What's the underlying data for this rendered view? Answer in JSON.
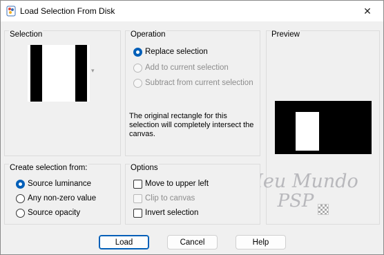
{
  "window": {
    "title": "Load Selection From Disk",
    "close_glyph": "✕"
  },
  "selection": {
    "label": "Selection",
    "dropdown_glyph": "▾"
  },
  "operation": {
    "label": "Operation",
    "options": [
      {
        "label": "Replace selection",
        "checked": true,
        "enabled": true
      },
      {
        "label": "Add to current selection",
        "checked": false,
        "enabled": false
      },
      {
        "label": "Subtract from current selection",
        "checked": false,
        "enabled": false
      }
    ],
    "message": "The original rectangle for this selection will completely intersect the canvas."
  },
  "preview": {
    "label": "Preview"
  },
  "create_from": {
    "label": "Create selection from:",
    "options": [
      {
        "label": "Source luminance",
        "checked": true
      },
      {
        "label": "Any non-zero value",
        "checked": false
      },
      {
        "label": "Source opacity",
        "checked": false
      }
    ]
  },
  "options": {
    "label": "Options",
    "items": [
      {
        "label": "Move to upper left",
        "checked": false,
        "enabled": true
      },
      {
        "label": "Clip to canvas",
        "checked": false,
        "enabled": false
      },
      {
        "label": "Invert selection",
        "checked": false,
        "enabled": true
      }
    ]
  },
  "watermark": {
    "line1": "Meu Mundo",
    "line2": "PSP"
  },
  "buttons": {
    "load": "Load",
    "cancel": "Cancel",
    "help": "Help"
  },
  "colors": {
    "accent": "#005fb8",
    "watermark": "#b8b8bc"
  }
}
